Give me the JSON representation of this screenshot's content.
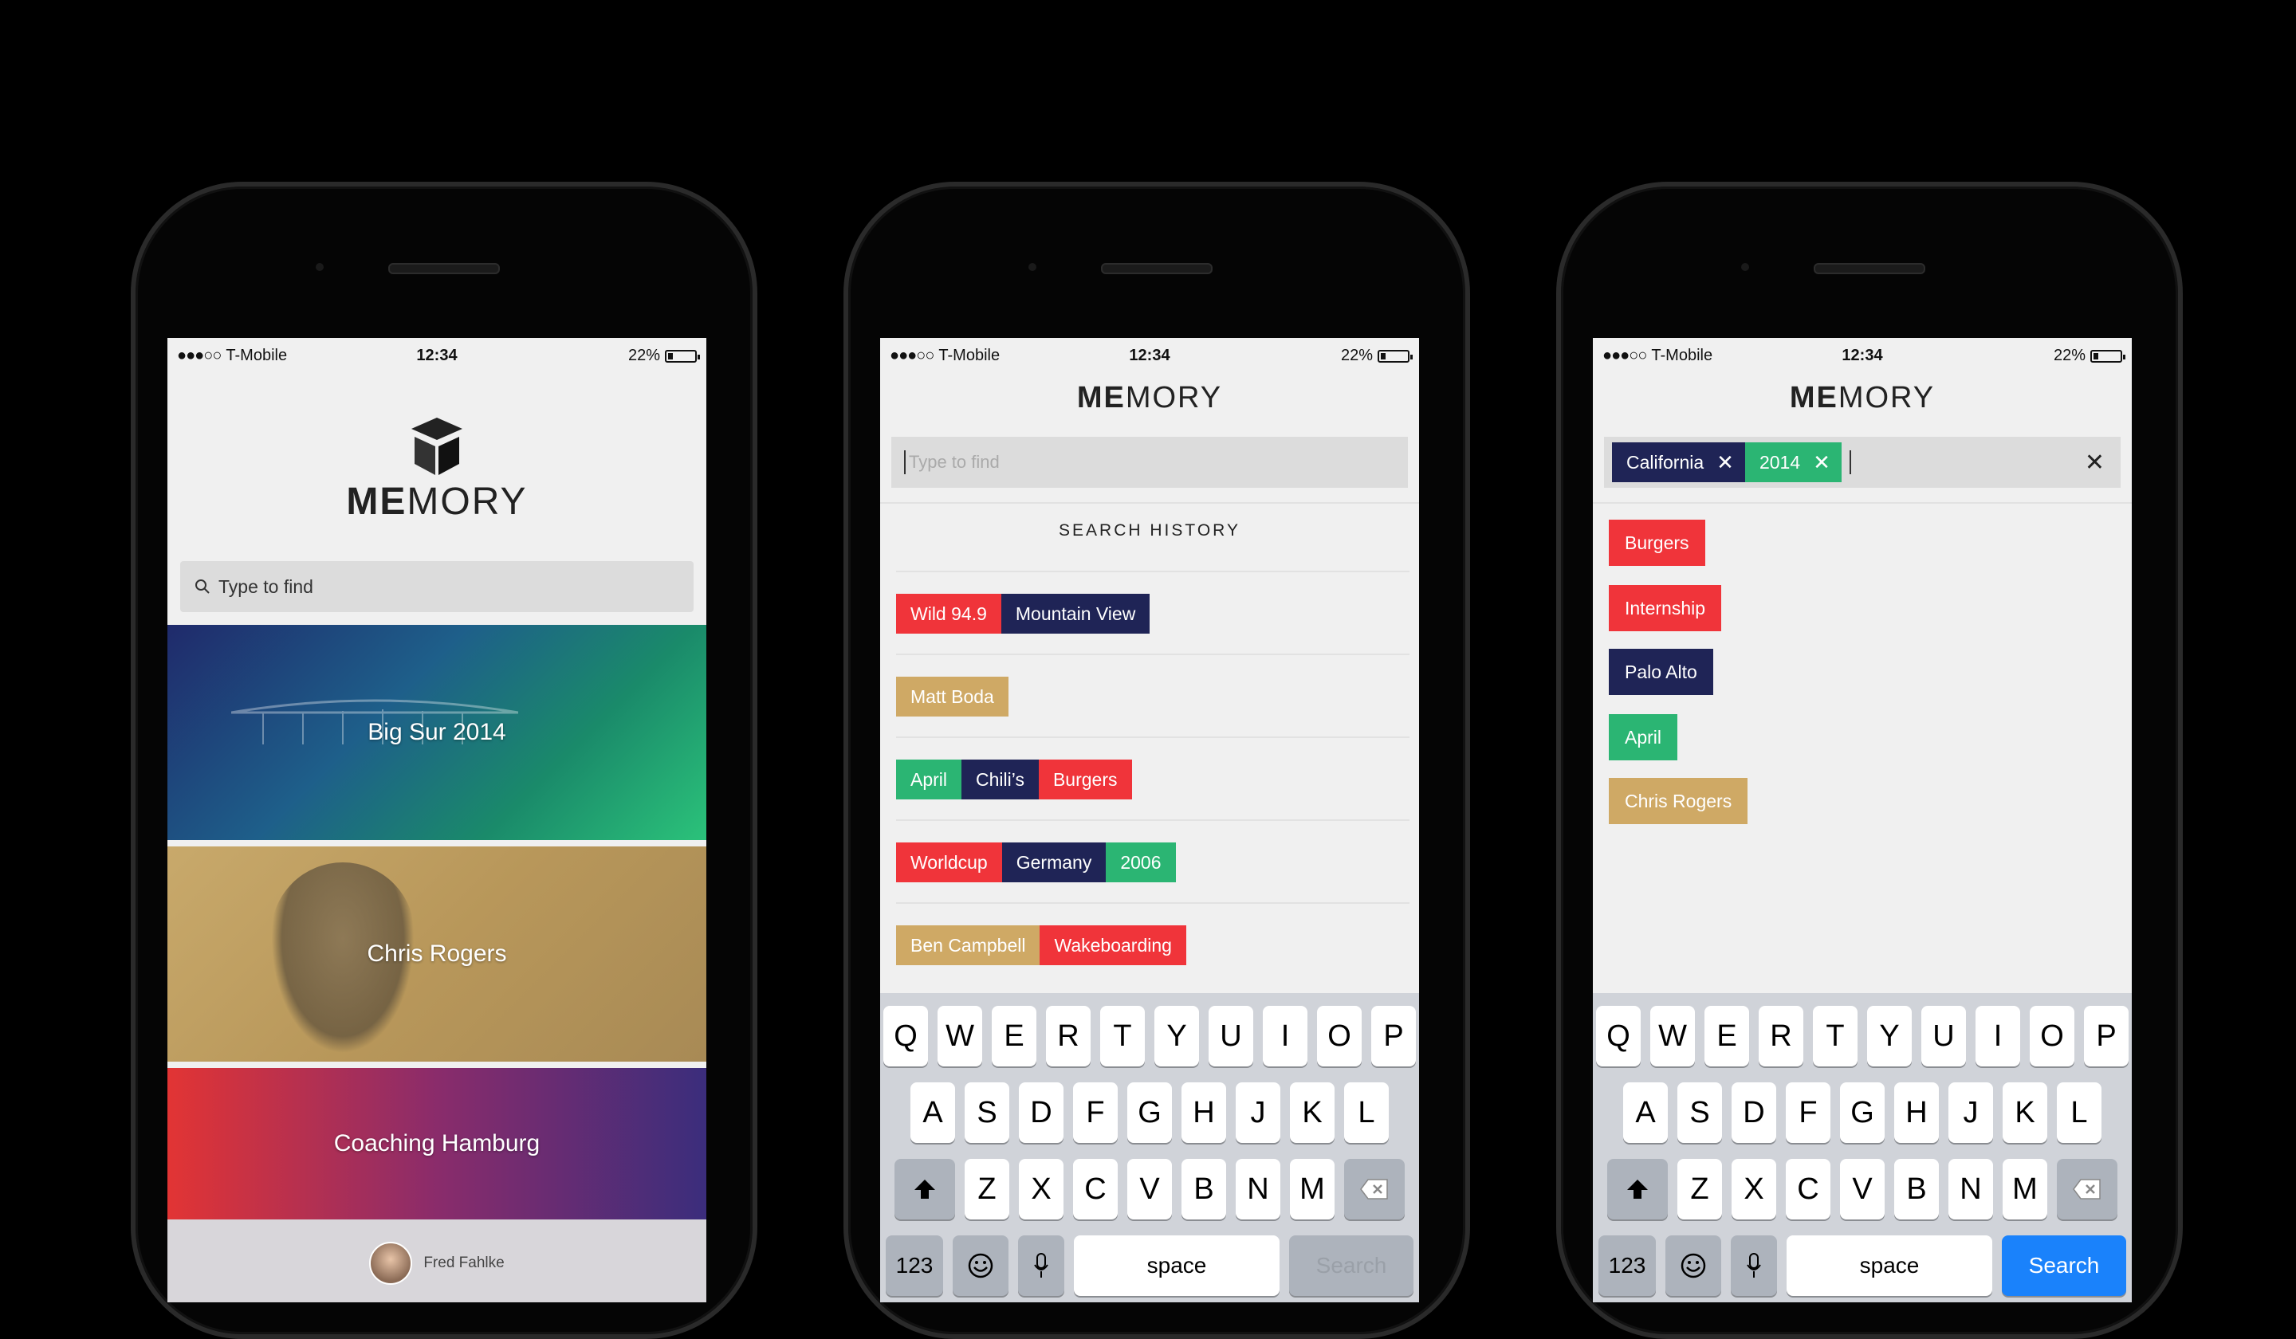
{
  "status": {
    "carrier": "T-Mobile",
    "time": "12:34",
    "battery": "22%"
  },
  "logo": {
    "bold": "ME",
    "rest": "MORY"
  },
  "phone1": {
    "search_label": "Type to find",
    "cards": [
      {
        "title": "Big Sur 2014"
      },
      {
        "title": "Chris Rogers"
      },
      {
        "title": "Coaching Hamburg"
      }
    ],
    "owner": "Fred Fahlke"
  },
  "phone2": {
    "search_placeholder": "Type to find",
    "history_title": "SEARCH HISTORY",
    "history": [
      [
        "Wild 94.9",
        "Mountain View"
      ],
      [
        "Matt Boda"
      ],
      [
        "April",
        "Chili’s",
        "Burgers"
      ],
      [
        "Worldcup",
        "Germany",
        "2006"
      ],
      [
        "Ben Campbell",
        "Wakeboarding"
      ]
    ]
  },
  "phone3": {
    "chips": [
      "California",
      "2014"
    ],
    "results": [
      "Burgers",
      "Internship",
      "Palo Alto",
      "April",
      "Chris Rogers"
    ]
  },
  "keyboard": {
    "row1": [
      "Q",
      "W",
      "E",
      "R",
      "T",
      "Y",
      "U",
      "I",
      "O",
      "P"
    ],
    "row2": [
      "A",
      "S",
      "D",
      "F",
      "G",
      "H",
      "J",
      "K",
      "L"
    ],
    "row3": [
      "Z",
      "X",
      "C",
      "V",
      "B",
      "N",
      "M"
    ],
    "num": "123",
    "space": "space",
    "return": "Search"
  },
  "colors": {
    "red": "#f0343a",
    "navy": "#1f2456",
    "green": "#2bb573",
    "tan": "#cfa965",
    "blue": "#1a82fb"
  }
}
